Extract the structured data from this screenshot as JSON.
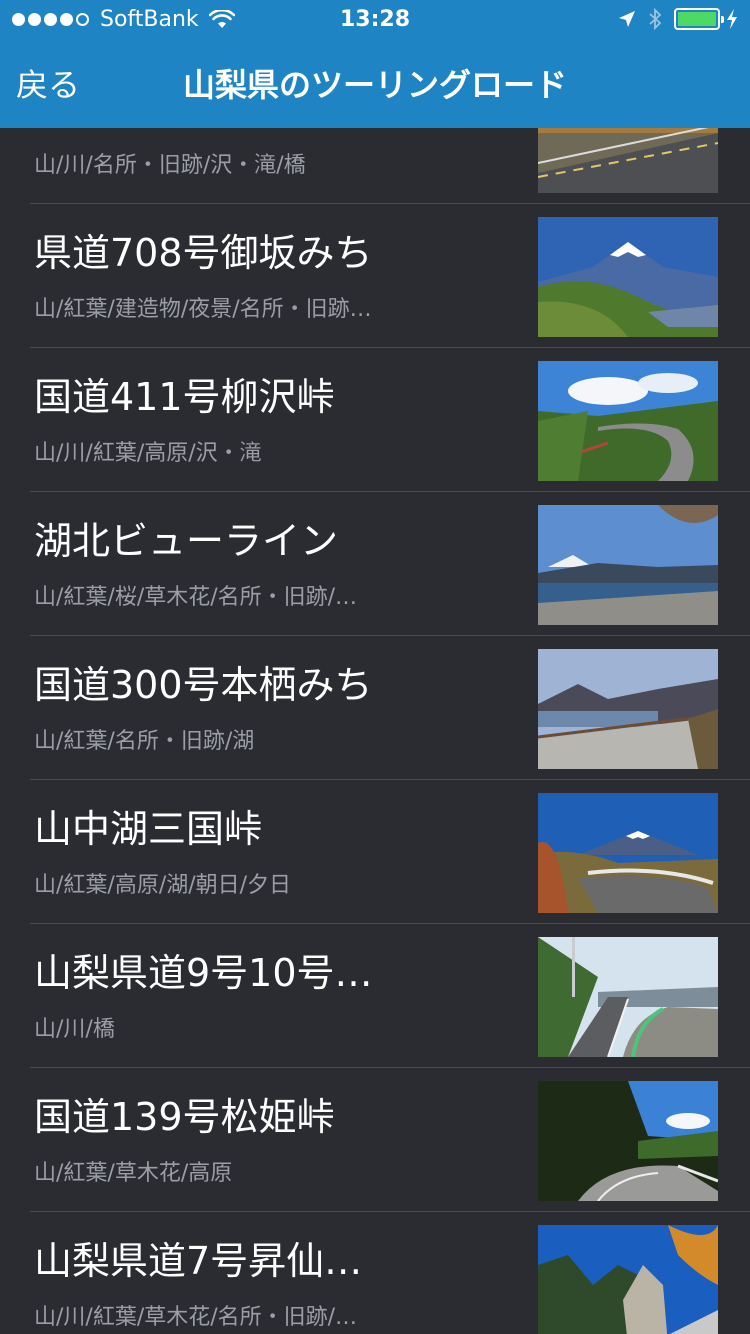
{
  "status_bar": {
    "carrier": "SoftBank",
    "time": "13:28",
    "signal_bars_filled": 4,
    "signal_bars_total": 5,
    "battery_level": 1.0,
    "battery_color": "#4cd964"
  },
  "nav": {
    "back_label": "戻る",
    "title": "山梨県のツーリングロード",
    "bar_color": "#1f84c4"
  },
  "roads": [
    {
      "title": "",
      "tags": "山/川/名所・旧跡/沢・滝/橋",
      "thumbnail": "mountain-road-curve"
    },
    {
      "title": "県道708号御坂みち",
      "tags": "山/紅葉/建造物/夜景/名所・旧跡…",
      "thumbnail": "mount-fuji-lake-view"
    },
    {
      "title": "国道411号柳沢峠",
      "tags": "山/川/紅葉/高原/沢・滝",
      "thumbnail": "forest-road-curve"
    },
    {
      "title": "湖北ビューライン",
      "tags": "山/紅葉/桜/草木花/名所・旧跡/…",
      "thumbnail": "lakeside-fuji-road"
    },
    {
      "title": "国道300号本栖みち",
      "tags": "山/紅葉/名所・旧跡/湖",
      "thumbnail": "lake-mountain-road"
    },
    {
      "title": "山中湖三国峠",
      "tags": "山/紅葉/高原/湖/朝日/夕日",
      "thumbnail": "fuji-guardrail-road"
    },
    {
      "title": "山梨県道9号10号…",
      "tags": "山/川/橋",
      "thumbnail": "valley-highway"
    },
    {
      "title": "国道139号松姫峠",
      "tags": "山/紅葉/草木花/高原",
      "thumbnail": "mountain-pass-road"
    },
    {
      "title": "山梨県道7号昇仙…",
      "tags": "山/川/紅葉/草木花/名所・旧跡/…",
      "thumbnail": "rocky-gorge-road"
    }
  ]
}
